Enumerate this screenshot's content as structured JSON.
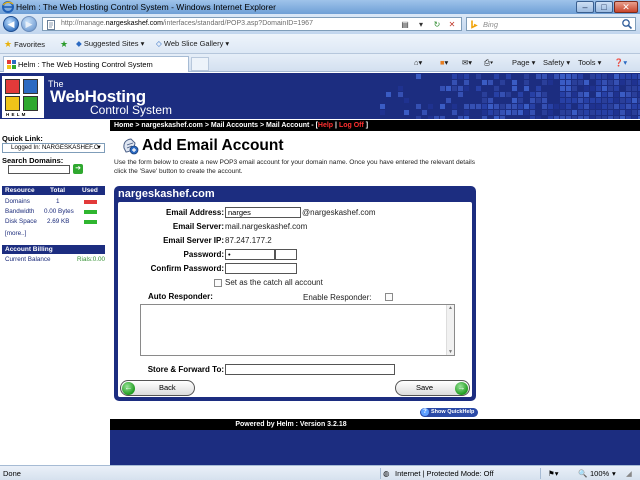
{
  "window": {
    "title": "Helm : The Web Hosting Control System - Windows Internet Explorer"
  },
  "address": {
    "prefix": "http://manage.",
    "domain": "nargeskashef.com",
    "suffix": "/interfaces/standard/POP3.asp?DomainID=1967",
    "search_placeholder": "Bing"
  },
  "favorites": {
    "favorites_label": "Favorites",
    "suggested_label": "Suggested Sites ▾",
    "webslice_label": "Web Slice Gallery ▾"
  },
  "tab": {
    "title": "Helm : The Web Hosting Control System"
  },
  "commandbar": {
    "page": "Page ▾",
    "safety": "Safety ▾",
    "tools": "Tools ▾"
  },
  "banner": {
    "the": "The",
    "webhosting": "WebHosting",
    "control_system": "Control System",
    "helm_letters": "H E L M"
  },
  "breadcrumb": {
    "text": "Home > nargeskashef.com > Mail Accounts > Mail Account - [",
    "help": "Help",
    "sep": "|",
    "logoff": "Log Off",
    "close": "]"
  },
  "sidebar": {
    "quick_link_label": "Quick Link:",
    "quick_link_value": "Logged In: NARGESKASHEF.C",
    "search_domains_label": "Search Domains:",
    "resource_headers": {
      "resource": "Resource",
      "total": "Total",
      "used": "Used"
    },
    "resources": [
      {
        "name": "Domains",
        "total": "1",
        "bar_color": "#e23a3a"
      },
      {
        "name": "Bandwidth",
        "total": "0.00 Bytes",
        "bar_color": "#2fb52f"
      },
      {
        "name": "Disk Space",
        "total": "2.69 KB",
        "bar_color": "#2fb52f"
      }
    ],
    "more": "[more..]",
    "account_billing": "Account Billing",
    "current_balance_label": "Current Balance",
    "current_balance_value": "Rials:0.00"
  },
  "main": {
    "title": "Add Email Account",
    "intro": "Use the form below to create a new POP3 email account for your domain name. Once you have entered the relevant details click the 'Save' button to create the account.",
    "panel_title": "nargeskashef.com",
    "form": {
      "email_address_label": "Email Address:",
      "email_address_value": "narges",
      "email_domain": "@nargeskashef.com",
      "email_server_label": "Email Server:",
      "email_server_value": "mail.nargeskashef.com",
      "email_server_ip_label": "Email Server IP:",
      "email_server_ip_value": "87.247.177.2",
      "password_label": "Password:",
      "password_value": "•",
      "confirm_password_label": "Confirm Password:",
      "catch_all_label": "Set as the catch all account",
      "auto_responder_label": "Auto Responder:",
      "enable_responder_label": "Enable Responder:",
      "store_forward_label": "Store & Forward To:"
    },
    "back_label": "Back",
    "save_label": "Save",
    "quickhelp": "Show QuickHelp",
    "footer": "Powered by Helm : Version 3.2.18"
  },
  "status": {
    "left": "Done",
    "zone": "Internet | Protected Mode: Off",
    "zoom": "100%"
  },
  "colors": {
    "brand_navy": "#1c2d80",
    "error_red": "#ff3030",
    "ok_green": "#2fb52f"
  }
}
